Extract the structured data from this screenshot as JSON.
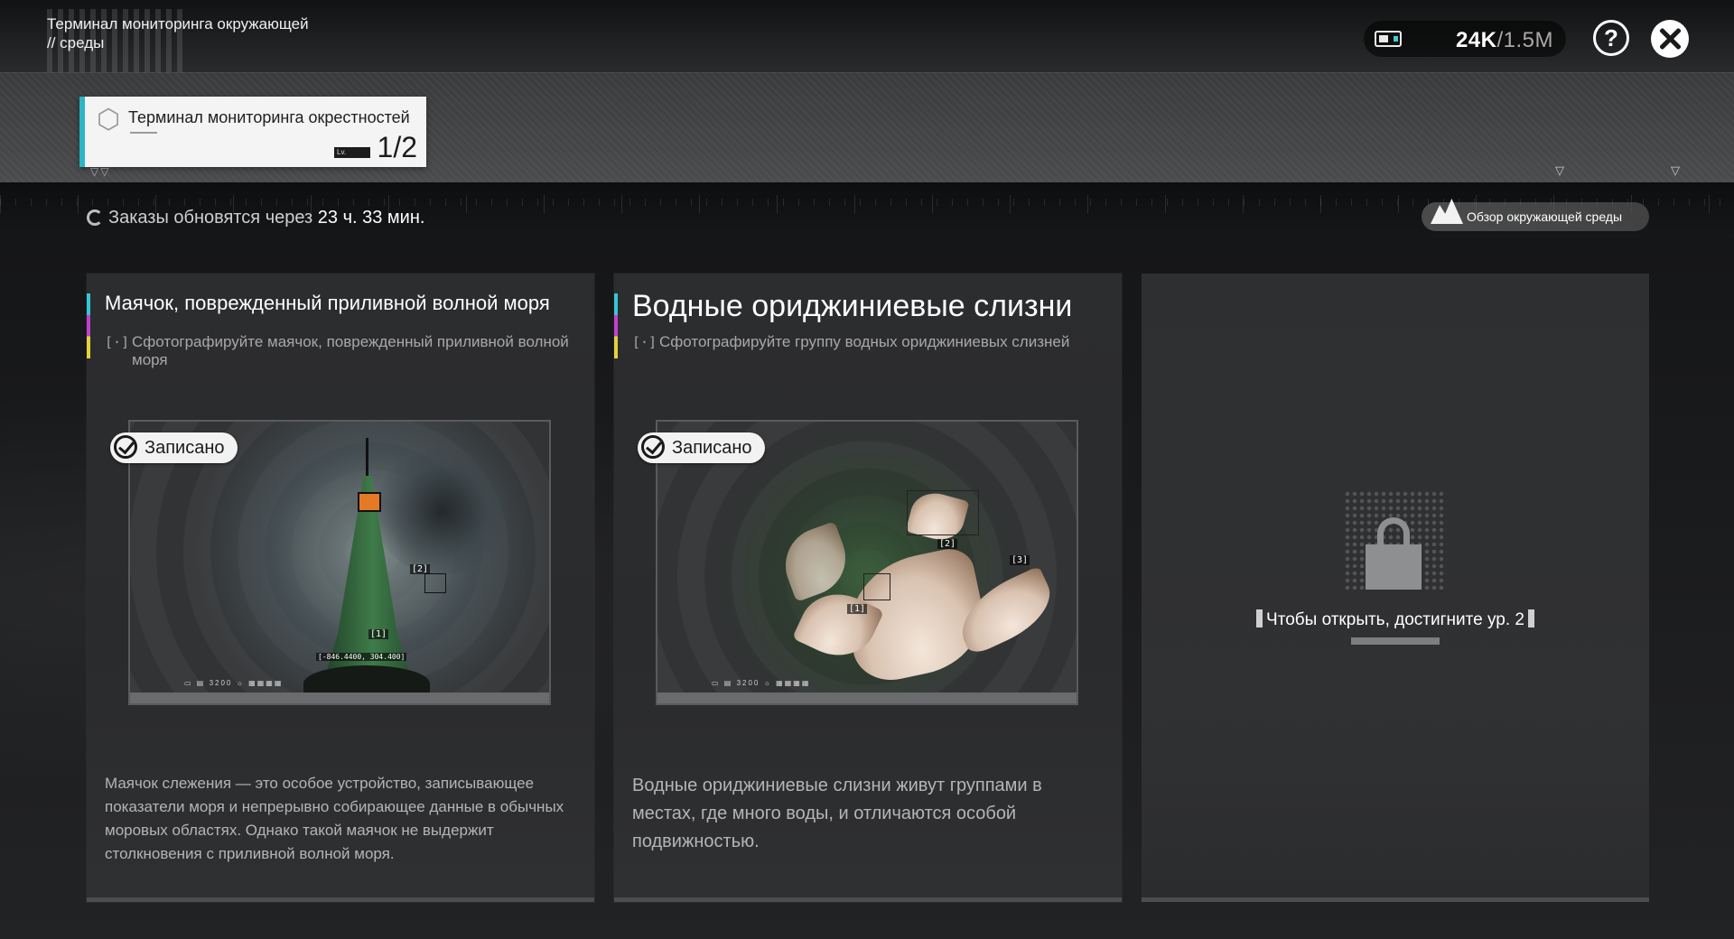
{
  "header": {
    "title_line1": "Терминал мониторинга окружающей",
    "title_line2": "// среды",
    "currency": {
      "icon": "battery-energy-icon",
      "current": "24K",
      "max": "/1.5M"
    },
    "help_label": "?",
    "close_icon": "close-icon"
  },
  "terminal_tab": {
    "label": "Терминал мониторинга окрестностей",
    "level_prefix": "Lv.",
    "level_value": "1/2",
    "accent_color": "#2bb6c6"
  },
  "refresh": {
    "prefix": "Заказы обновятся через ",
    "time": "23 ч. 33 мин."
  },
  "overview_button": {
    "label": "Обзор окружающей среды",
    "icon": "mountain-icon"
  },
  "cards": [
    {
      "title": "Маячок, поврежденный приливной волной моря",
      "subtitle": "Сфотографируйте маячок, поврежденный приливной волной моря",
      "subtitle_icon": "[·]",
      "status": "Записано",
      "photo_tags": [
        "[2]",
        "[1]",
        "[-846.4400, 304.400]"
      ],
      "description": "Маячок слежения — это особое устройство, записывающее показатели моря и непрерывно собирающее данные в обычных моровых областях. Однако такой маячок не выдержит столкновения с приливной волной моря."
    },
    {
      "title": "Водные ориджиниевые слизни",
      "subtitle": "Сфотографируйте группу водных ориджиниевых слизней",
      "subtitle_icon": "[·]",
      "status": "Записано",
      "photo_tags": [
        "[1]",
        "[2]",
        "[3]"
      ],
      "description": "Водные ориджиниевые слизни живут группами в местах, где много воды, и отличаются особой подвижностью."
    }
  ],
  "locked_card": {
    "text": "Чтобы открыть, достигните ур. 2",
    "icon": "lock-icon"
  }
}
